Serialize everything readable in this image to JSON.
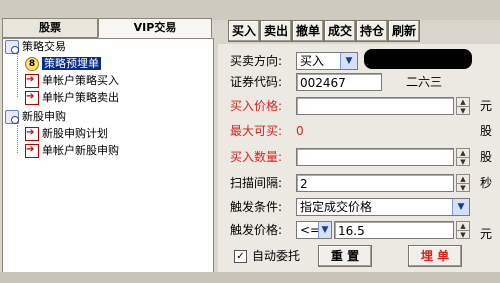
{
  "tabs": {
    "stocks": "股票",
    "vip": "VIP交易"
  },
  "tree": {
    "group1": "策略交易",
    "item_selected": "策略预埋单",
    "item2": "单帐户策略买入",
    "item3": "单帐户策略卖出",
    "group2": "新股申购",
    "item4": "新股申购计划",
    "item5": "单帐户新股申购"
  },
  "toolbar": [
    "买入",
    "卖出",
    "撤单",
    "成交",
    "持仓",
    "刷新"
  ],
  "form": {
    "direction_label": "买卖方向:",
    "direction_value": "买入",
    "code_label": "证券代码:",
    "code_value": "002467",
    "stock_name": "二六三",
    "price_label": "买入价格:",
    "price_unit": "元",
    "max_label": "最大可买:",
    "max_value": "0",
    "max_unit": "股",
    "qty_label": "买入数量:",
    "qty_unit": "股",
    "interval_label": "扫描间隔:",
    "interval_value": "2",
    "interval_unit": "秒",
    "cond_label": "触发条件:",
    "cond_value": "指定成交价格",
    "trigger_label": "触发价格:",
    "trigger_op": "<=",
    "trigger_value": "16.5",
    "trigger_unit": "元",
    "auto_label": "自动委托",
    "reset_btn": "重 置",
    "submit_btn": "埋 单"
  },
  "colors": {
    "red_text": "#d22222",
    "selection": "#0a2a8a",
    "submit_text": "#d22222"
  }
}
